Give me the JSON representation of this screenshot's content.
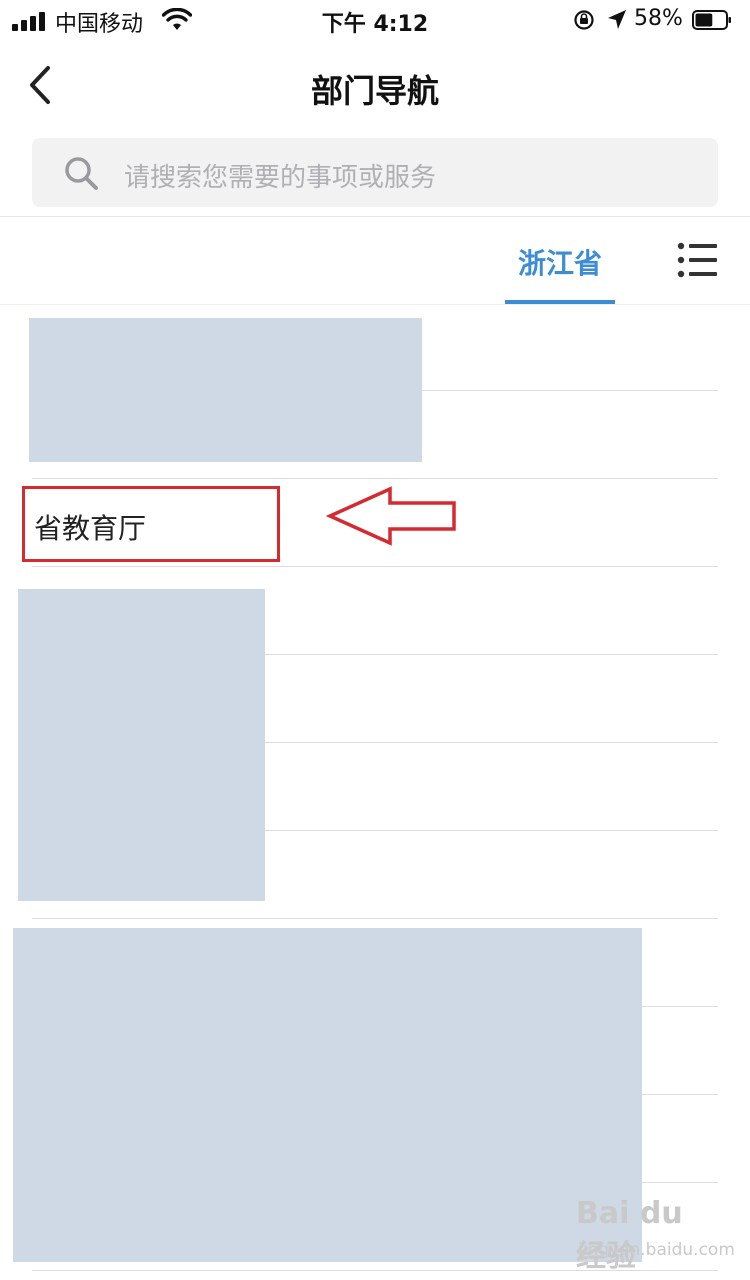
{
  "status_bar": {
    "carrier": "中国移动",
    "time": "下午 4:12",
    "battery": "58%",
    "battery_level": 0.58
  },
  "nav": {
    "title": "部门导航",
    "back_icon": "chevron-left-icon"
  },
  "search": {
    "placeholder": "请搜索您需要的事项或服务",
    "icon": "search-icon"
  },
  "tabs": {
    "active": "浙江省",
    "menu_icon": "list-icon",
    "accent_color": "#3c8dd6"
  },
  "list": {
    "highlighted_item": "省教育厅",
    "redaction_color": "#cfd8e5",
    "annotation_color": "#d52a2f"
  },
  "watermark": {
    "logo": "Bai du 经验",
    "url": "jingyan.baidu.com"
  }
}
